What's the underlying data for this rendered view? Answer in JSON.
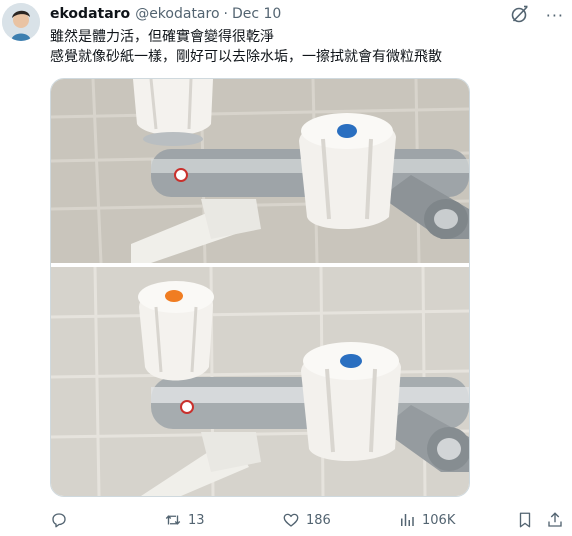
{
  "user": {
    "display_name": "ekodataro",
    "handle": "@ekodataro",
    "separator": "·",
    "date": "Dec 10"
  },
  "tweet": {
    "lines": [
      "雖然是體力活，但確實會變得很乾淨",
      "感覺就像砂紙一樣，剛好可以去除水垢，一擦拭就會有微粒飛散"
    ]
  },
  "top_icons": {
    "grok": "grok-icon",
    "more": "more-icon",
    "more_glyph": "···"
  },
  "media": {
    "images": [
      {
        "name": "faucet-photo-before",
        "handle_dot_color": "#2a6fc0"
      },
      {
        "name": "faucet-photo-after",
        "left_dot_color": "#f07d22",
        "right_dot_color": "#2a6fc0"
      }
    ]
  },
  "actions": {
    "reply": {
      "icon": "reply-icon",
      "count": ""
    },
    "retweet": {
      "icon": "retweet-icon",
      "count": "13"
    },
    "like": {
      "icon": "heart-icon",
      "count": "186"
    },
    "views": {
      "icon": "views-icon",
      "count": "106K"
    },
    "bookmark": {
      "icon": "bookmark-icon"
    },
    "share": {
      "icon": "share-icon"
    }
  },
  "colors": {
    "text": "#0f1419",
    "muted": "#536471",
    "border": "#cfd9de"
  }
}
